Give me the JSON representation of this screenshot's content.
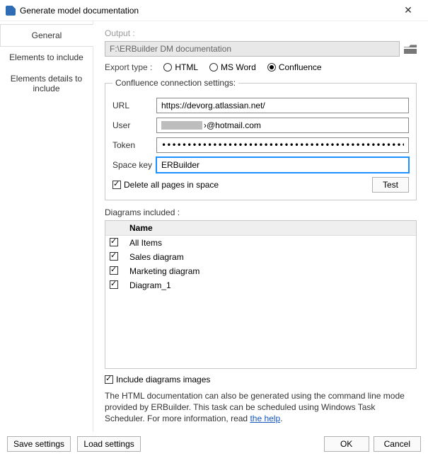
{
  "window": {
    "title": "Generate model documentation"
  },
  "sidebar": {
    "tabs": [
      {
        "label": "General"
      },
      {
        "label": "Elements to include"
      },
      {
        "label": "Elements details to include"
      }
    ]
  },
  "main": {
    "output_label": "Output  :",
    "output_path": "F:\\ERBuilder DM documentation",
    "export_label": "Export type :",
    "export_options": [
      {
        "label": "HTML",
        "checked": false
      },
      {
        "label": "MS Word",
        "checked": false
      },
      {
        "label": "Confluence",
        "checked": true
      }
    ],
    "conn": {
      "legend": "Confluence connection settings:",
      "url_label": "URL",
      "url_value": "https://devorg.atlassian.net/",
      "user_label": "User",
      "user_value": "›@hotmail.com",
      "token_label": "Token",
      "token_value": "•••••••••••••••••••••••••••••••••••••••••••••••••••••••••••••••••••",
      "space_label": "Space key",
      "space_value": "ERBuilder",
      "delete_pages_label": "Delete all pages in space",
      "delete_pages_checked": true,
      "test_button": "Test"
    },
    "diagrams_label": "Diagrams included :",
    "grid_name_header": "Name",
    "diagrams": [
      {
        "name": "All Items",
        "checked": true
      },
      {
        "name": "Sales diagram",
        "checked": true
      },
      {
        "name": "Marketing diagram",
        "checked": true
      },
      {
        "name": "Diagram_1",
        "checked": true
      }
    ],
    "include_images_label": "Include diagrams images",
    "include_images_checked": true,
    "help_text_pre": "The HTML documentation can also be generated using the command line mode provided by ERBuilder. This task can be scheduled using Windows Task Scheduler. For more information, read ",
    "help_link": "the help",
    "help_text_post": "."
  },
  "footer": {
    "save_settings": "Save settings",
    "load_settings": "Load settings",
    "ok": "OK",
    "cancel": "Cancel"
  }
}
